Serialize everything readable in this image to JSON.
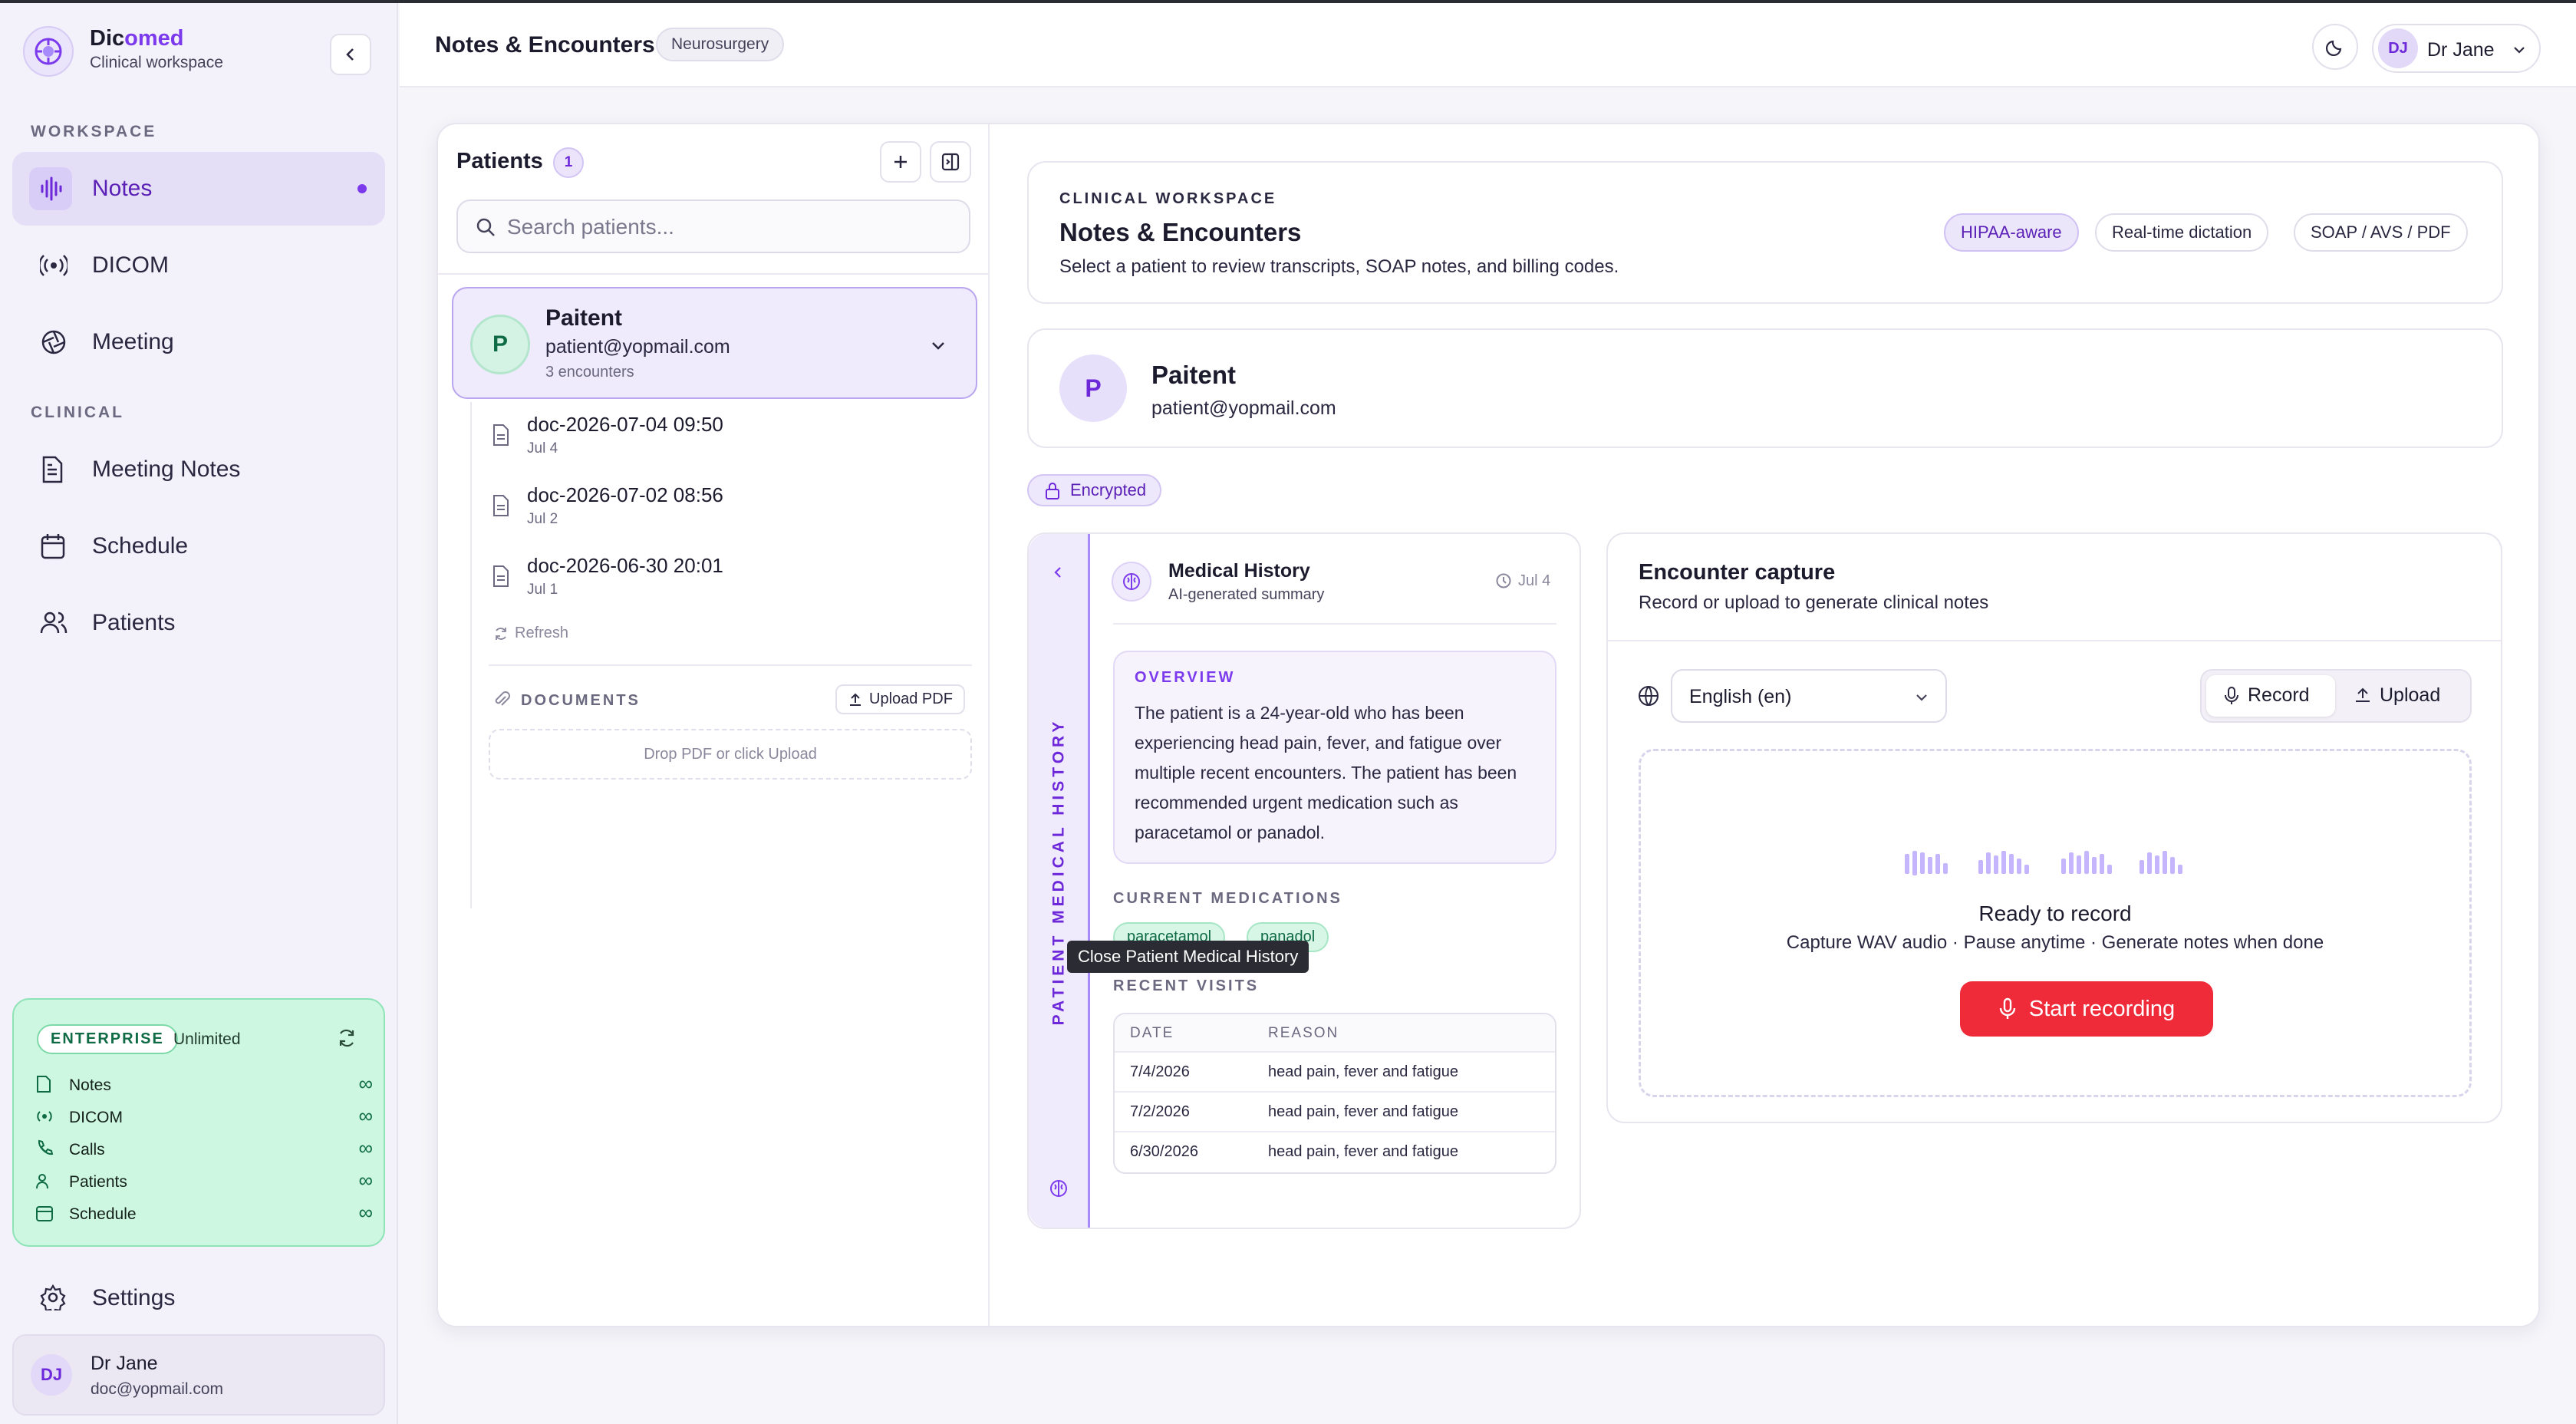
{
  "sidebar": {
    "brand_name_a": "Dic",
    "brand_name_b": "omed",
    "brand_sub": "Clinical workspace",
    "sections": {
      "workspace": "WORKSPACE",
      "clinical": "CLINICAL"
    },
    "items": {
      "notes": "Notes",
      "dicom": "DICOM",
      "meeting": "Meeting",
      "meeting_notes": "Meeting Notes",
      "schedule": "Schedule",
      "patients": "Patients",
      "settings": "Settings"
    },
    "plan": {
      "badge": "ENTERPRISE",
      "tier": "Unlimited",
      "rows": [
        "Notes",
        "DICOM",
        "Calls",
        "Patients",
        "Schedule"
      ],
      "infinity": "∞"
    },
    "user": {
      "initials": "DJ",
      "name": "Dr Jane",
      "email": "doc@yopmail.com"
    }
  },
  "header": {
    "title": "Notes & Encounters",
    "department": "Neurosurgery",
    "user_initials": "DJ",
    "user_name": "Dr Jane"
  },
  "patients_panel": {
    "title": "Patients",
    "count": "1",
    "search_placeholder": "Search patients...",
    "patient": {
      "initial": "P",
      "name": "Paitent",
      "email": "patient@yopmail.com",
      "encounters": "3 encounters"
    },
    "docs": [
      {
        "name": "doc-2026-07-04 09:50",
        "date": "Jul 4"
      },
      {
        "name": "doc-2026-07-02 08:56",
        "date": "Jul 2"
      },
      {
        "name": "doc-2026-06-30 20:01",
        "date": "Jul 1"
      }
    ],
    "refresh": "Refresh",
    "documents_label": "DOCUMENTS",
    "upload_pdf": "Upload PDF",
    "drop_hint": "Drop PDF or click Upload"
  },
  "workspace": {
    "eyebrow": "CLINICAL WORKSPACE",
    "title": "Notes & Encounters",
    "subtitle": "Select a patient to review transcripts, SOAP notes, and billing codes.",
    "chips": [
      "HIPAA-aware",
      "Real-time dictation",
      "SOAP / AVS / PDF"
    ],
    "patient_initial": "P",
    "patient_name": "Paitent",
    "patient_email": "patient@yopmail.com",
    "encrypted": "Encrypted"
  },
  "history": {
    "vertical_label": "PATIENT MEDICAL HISTORY",
    "title": "Medical History",
    "subtitle": "AI-generated summary",
    "date": "Jul 4",
    "overview_label": "OVERVIEW",
    "overview": "The patient is a 24-year-old who has been experiencing head pain, fever, and fatigue over multiple recent encounters. The patient has been recommended urgent medication such as paracetamol or panadol.",
    "meds_label": "CURRENT MEDICATIONS",
    "meds": [
      "paracetamol",
      "panadol"
    ],
    "tooltip": "Close Patient Medical History",
    "visits_label": "RECENT VISITS",
    "visits_headers": [
      "DATE",
      "REASON"
    ],
    "visits": [
      {
        "date": "7/4/2026",
        "reason": "head pain, fever and fatigue"
      },
      {
        "date": "7/2/2026",
        "reason": "head pain, fever and fatigue"
      },
      {
        "date": "6/30/2026",
        "reason": "head pain, fever and fatigue"
      }
    ]
  },
  "capture": {
    "title": "Encounter capture",
    "subtitle": "Record or upload to generate clinical notes",
    "language": "English (en)",
    "record": "Record",
    "upload": "Upload",
    "ready": "Ready to record",
    "hint": "Capture WAV audio · Pause anytime · Generate notes when done",
    "start": "Start recording"
  },
  "colors": {
    "accent": "#7c3aed",
    "record": "#ef2b3a",
    "plan": "#cdf7e0"
  }
}
